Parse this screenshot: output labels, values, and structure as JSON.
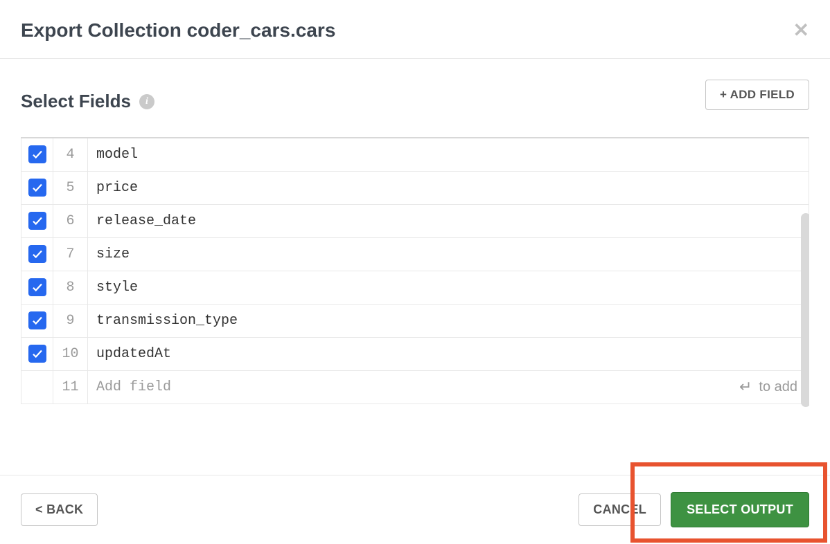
{
  "header": {
    "title": "Export Collection coder_cars.cars"
  },
  "section": {
    "title": "Select Fields",
    "addFieldLabel": "+ ADD FIELD"
  },
  "fields": [
    {
      "num": "4",
      "name": "model",
      "checked": true
    },
    {
      "num": "5",
      "name": "price",
      "checked": true
    },
    {
      "num": "6",
      "name": "release_date",
      "checked": true
    },
    {
      "num": "7",
      "name": "size",
      "checked": true
    },
    {
      "num": "8",
      "name": "style",
      "checked": true
    },
    {
      "num": "9",
      "name": "transmission_type",
      "checked": true
    },
    {
      "num": "10",
      "name": "updatedAt",
      "checked": true
    }
  ],
  "addRow": {
    "num": "11",
    "placeholder": "Add field",
    "hint": "to add"
  },
  "footer": {
    "back": "<  BACK",
    "cancel": "CANCEL",
    "primary": "SELECT OUTPUT"
  }
}
